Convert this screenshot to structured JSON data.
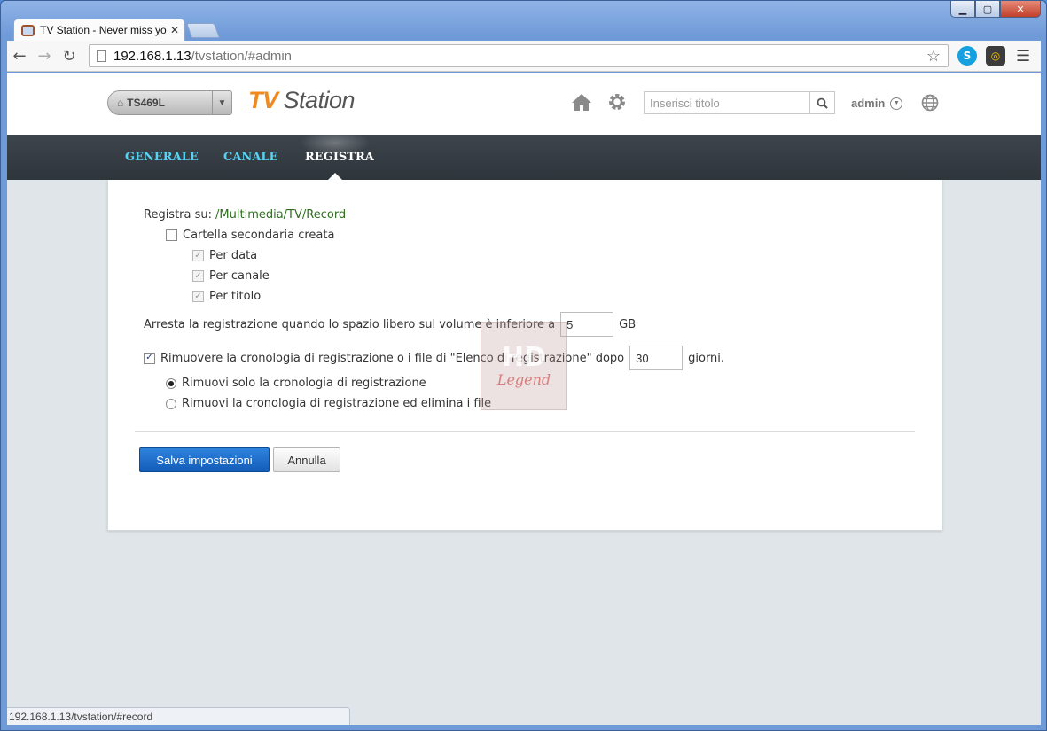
{
  "browser": {
    "tab_title": "TV Station - Never miss yo",
    "url_host": "192.168.1.13",
    "url_path": "/tvstation/#admin",
    "window_controls": {
      "minimize": "▁",
      "maximize": "▢",
      "close": "✕"
    },
    "status_url": "192.168.1.13/tvstation/#record"
  },
  "header": {
    "device": "TS469L",
    "logo_tv": "TV",
    "logo_station": "Station",
    "search_placeholder": "Inserisci titolo",
    "user": "admin"
  },
  "nav": {
    "items": [
      {
        "label": "GENERALE",
        "active": false
      },
      {
        "label": "CANALE",
        "active": false
      },
      {
        "label": "REGISTRA",
        "active": true
      }
    ]
  },
  "record": {
    "save_to_label": "Registra su:",
    "save_to_path": "/Multimedia/TV/Record",
    "subfolder_label": "Cartella secondaria creata",
    "subfolder_checked": false,
    "by_date": "Per data",
    "by_channel": "Per canale",
    "by_title": "Per titolo",
    "stop_label": "Arresta la registrazione quando lo spazio libero sul volume è inferiore a",
    "stop_value": "5",
    "stop_unit": "GB",
    "remove_label": "Rimuovere la cronologia di registrazione o i file di \"Elenco di registrazione\" dopo",
    "remove_checked": true,
    "remove_days": "30",
    "remove_unit": "giorni.",
    "option_history_only": "Rimuovi solo la cronologia di registrazione",
    "option_history_and_files": "Rimuovi la cronologia di registrazione ed elimina i file",
    "selected_option": "history_only"
  },
  "actions": {
    "save": "Salva impostazioni",
    "cancel": "Annulla"
  },
  "watermark": {
    "top": "HD",
    "bottom": "Legend"
  }
}
